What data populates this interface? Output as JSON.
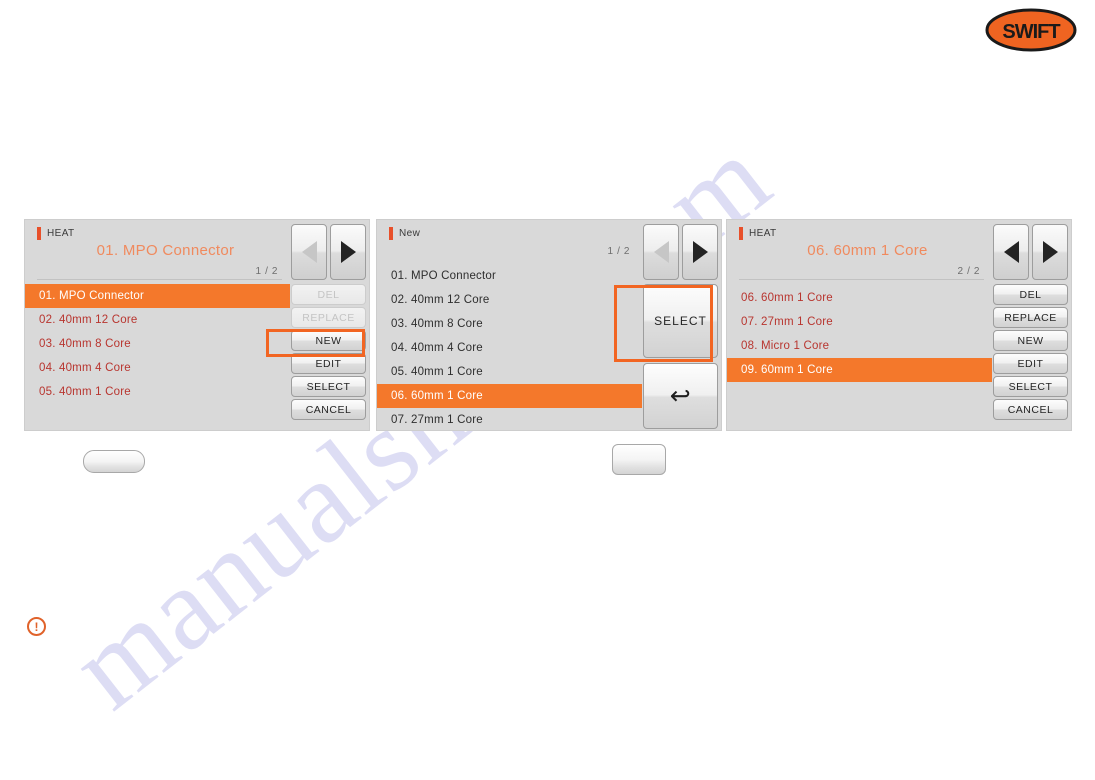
{
  "logo": {
    "brand": "SWIFT",
    "shape": "ellipse",
    "fill": "#ef6421",
    "stroke": "#1a1a1a"
  },
  "watermark": {
    "text": "manualshive.com",
    "color": "#c9c9ee"
  },
  "panels": [
    {
      "id": "panel-1",
      "mode_label": "HEAT",
      "profile_title": "01. MPO Connector",
      "page_indicator": "1 / 2",
      "nav": {
        "prev_icon": "triangle-left-icon",
        "prev_enabled": false,
        "next_icon": "triangle-right-icon",
        "next_enabled": true
      },
      "list": [
        {
          "label": "01. MPO Connector",
          "selected": true,
          "tone": "red"
        },
        {
          "label": "02. 40mm 12 Core",
          "selected": false,
          "tone": "red"
        },
        {
          "label": "03. 40mm 8 Core",
          "selected": false,
          "tone": "red"
        },
        {
          "label": "04. 40mm 4 Core",
          "selected": false,
          "tone": "red"
        },
        {
          "label": "05. 40mm 1 Core",
          "selected": false,
          "tone": "red"
        }
      ],
      "buttons": [
        {
          "label": "DEL",
          "enabled": false,
          "highlighted": false
        },
        {
          "label": "REPLACE",
          "enabled": false,
          "highlighted": false
        },
        {
          "label": "NEW",
          "enabled": true,
          "highlighted": true
        },
        {
          "label": "EDIT",
          "enabled": true,
          "highlighted": false
        },
        {
          "label": "SELECT",
          "enabled": true,
          "highlighted": false
        },
        {
          "label": "CANCEL",
          "enabled": true,
          "highlighted": false
        }
      ]
    },
    {
      "id": "panel-2",
      "mode_label": "New",
      "profile_title": "",
      "page_indicator": "1 / 2",
      "nav": {
        "prev_icon": "triangle-left-icon",
        "prev_enabled": false,
        "next_icon": "triangle-right-icon",
        "next_enabled": true
      },
      "list": [
        {
          "label": "01. MPO Connector",
          "selected": false,
          "tone": "dark"
        },
        {
          "label": "02. 40mm 12 Core",
          "selected": false,
          "tone": "dark"
        },
        {
          "label": "03. 40mm 8 Core",
          "selected": false,
          "tone": "dark"
        },
        {
          "label": "04. 40mm 4 Core",
          "selected": false,
          "tone": "dark"
        },
        {
          "label": "05. 40mm 1 Core",
          "selected": false,
          "tone": "dark"
        },
        {
          "label": "06. 60mm 1 Core",
          "selected": true,
          "tone": "dark"
        },
        {
          "label": "07. 27mm 1 Core",
          "selected": false,
          "tone": "dark"
        }
      ],
      "select_button": {
        "label": "SELECT",
        "enabled": true,
        "highlighted": true
      },
      "back_button": {
        "icon": "back-arrow-icon",
        "glyph": "↩",
        "enabled": true
      }
    },
    {
      "id": "panel-3",
      "mode_label": "HEAT",
      "profile_title": "06. 60mm 1 Core",
      "page_indicator": "2 / 2",
      "nav": {
        "prev_icon": "triangle-left-icon",
        "prev_enabled": true,
        "next_icon": "triangle-right-icon",
        "next_enabled": true
      },
      "list": [
        {
          "label": "06. 60mm 1 Core",
          "selected": false,
          "tone": "red"
        },
        {
          "label": "07. 27mm 1 Core",
          "selected": false,
          "tone": "red"
        },
        {
          "label": "08. Micro 1 Core",
          "selected": false,
          "tone": "red"
        },
        {
          "label": "09. 60mm 1 Core",
          "selected": true,
          "tone": "red"
        }
      ],
      "buttons": [
        {
          "label": "DEL",
          "enabled": true,
          "highlighted": false
        },
        {
          "label": "REPLACE",
          "enabled": true,
          "highlighted": false
        },
        {
          "label": "NEW",
          "enabled": true,
          "highlighted": false
        },
        {
          "label": "EDIT",
          "enabled": true,
          "highlighted": false
        },
        {
          "label": "SELECT",
          "enabled": true,
          "highlighted": false
        },
        {
          "label": "CANCEL",
          "enabled": true,
          "highlighted": false
        }
      ]
    }
  ],
  "stray_buttons": [
    {
      "id": "stray-1",
      "label": ""
    },
    {
      "id": "stray-2",
      "label": ""
    }
  ],
  "notice": {
    "icon": "exclamation-circle-icon",
    "glyph": "!",
    "color": "#e0622a",
    "text": ""
  },
  "colors": {
    "accent_orange": "#f4782b",
    "brand_orange": "#ef6421",
    "highlight_ring": "#f26522",
    "panel_bg": "#d9d9d9",
    "list_red": "#b8352f",
    "title_orange": "#f08a5e"
  }
}
